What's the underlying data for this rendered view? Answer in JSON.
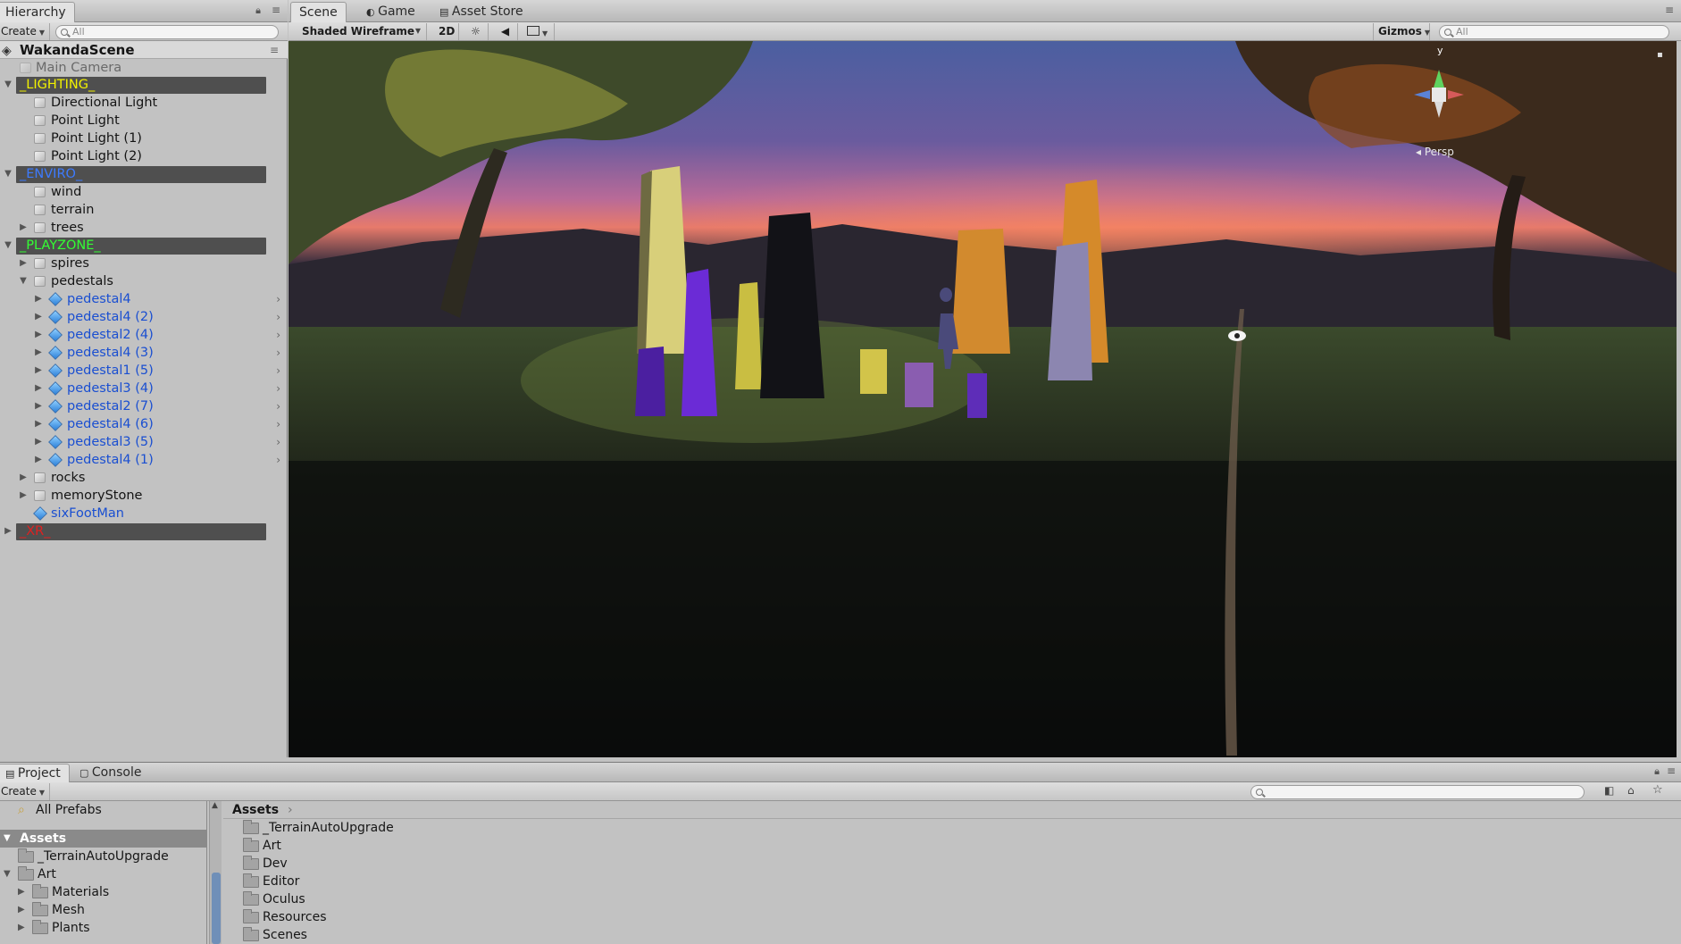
{
  "hierarchy": {
    "tab": "Hierarchy",
    "create": "Create",
    "search_placeholder": "All",
    "scene_name": "WakandaScene",
    "rows": {
      "main_camera": "Main Camera",
      "lighting": "_LIGHTING_",
      "directional_light": "Directional Light",
      "point_light": "Point Light",
      "point_light_1": "Point Light (1)",
      "point_light_2": "Point Light (2)",
      "enviro": "_ENVIRO_",
      "wind": "wind",
      "terrain": "terrain",
      "trees": "trees",
      "playzone": "_PLAYZONE_",
      "spires": "spires",
      "pedestals": "pedestals",
      "rocks": "rocks",
      "memory_stone": "memoryStone",
      "six_foot_man": "sixFootMan",
      "xr": "_XR_"
    },
    "pedestal_children": [
      "pedestal4",
      "pedestal4 (2)",
      "pedestal2 (4)",
      "pedestal4 (3)",
      "pedestal1 (5)",
      "pedestal3 (4)",
      "pedestal2 (7)",
      "pedestal4 (6)",
      "pedestal3 (5)",
      "pedestal4 (1)"
    ]
  },
  "scene": {
    "tabs": {
      "scene": "Scene",
      "game": "Game",
      "asset_store": "Asset Store"
    },
    "shading_mode": "Shaded Wireframe",
    "mode_2d": "2D",
    "gizmos": "Gizmos",
    "search_placeholder": "All",
    "gizmo": {
      "y_label": "y",
      "persp": "Persp"
    }
  },
  "project": {
    "tabs": {
      "project": "Project",
      "console": "Console"
    },
    "create": "Create",
    "all_prefabs": "All Prefabs",
    "tree_assets": "Assets",
    "tree": {
      "terrain_auto": "_TerrainAutoUpgrade",
      "art": "Art",
      "materials": "Materials",
      "mesh": "Mesh",
      "plants": "Plants"
    },
    "breadcrumb": "Assets",
    "folders": [
      "_TerrainAutoUpgrade",
      "Art",
      "Dev",
      "Editor",
      "Oculus",
      "Resources",
      "Scenes"
    ]
  },
  "colors": {
    "lighting_label": "#f2f200",
    "enviro_label": "#3d7bff",
    "playzone_label": "#33ff33",
    "xr_label": "#e02020",
    "prefab_text": "#1a4fd1"
  }
}
